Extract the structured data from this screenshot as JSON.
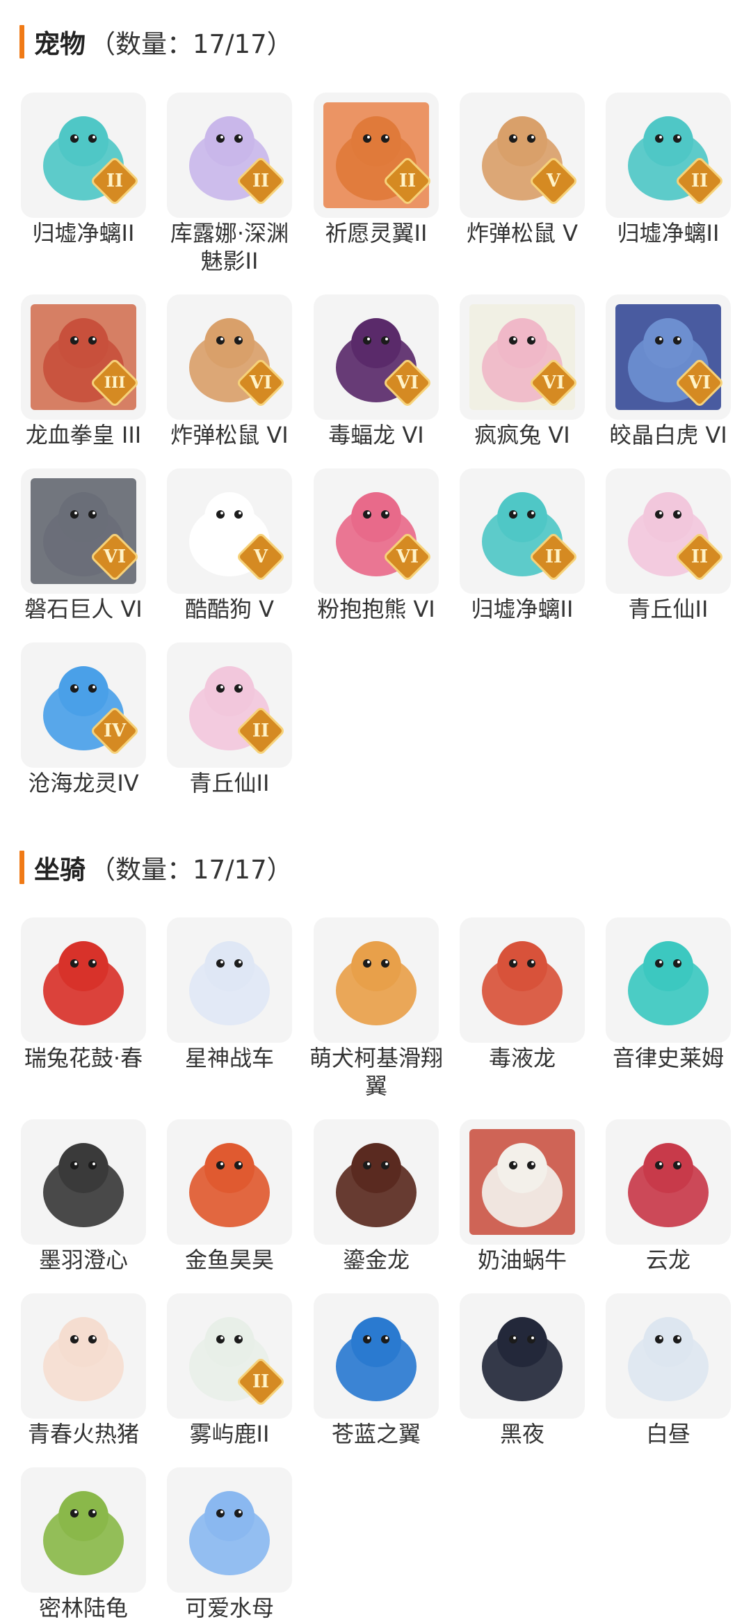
{
  "pets": {
    "title": "宠物",
    "count": "（数量：17/17）",
    "items": [
      {
        "name": "归墟净螭II",
        "icon": "jade-dragon-icon",
        "tier": "II",
        "color": "#4fc7c6",
        "bg": "#f4f4f4"
      },
      {
        "name": "库露娜·深渊魅影II",
        "icon": "abyss-girl-icon",
        "tier": "II",
        "color": "#c9b7ea",
        "bg": "#f4f4f4"
      },
      {
        "name": "祈愿灵翼II",
        "icon": "eagle-spirit-icon",
        "tier": "II",
        "color": "#e07a3a",
        "bg": "#e9824a"
      },
      {
        "name": "炸弹松鼠 V",
        "icon": "bomb-squirrel-icon",
        "tier": "V",
        "color": "#d9a06a",
        "bg": "#f4f4f4"
      },
      {
        "name": "归墟净螭II",
        "icon": "jade-dragon-icon",
        "tier": "II",
        "color": "#4fc7c6",
        "bg": "#f4f4f4"
      },
      {
        "name": "龙血拳皇 III",
        "icon": "ram-beast-icon",
        "tier": "III",
        "color": "#c8503c",
        "bg": "#d06a4a"
      },
      {
        "name": "炸弹松鼠 VI",
        "icon": "bomb-squirrel-icon",
        "tier": "VI",
        "color": "#d9a06a",
        "bg": "#f4f4f4"
      },
      {
        "name": "毒蝠龙 VI",
        "icon": "poison-bat-dragon-icon",
        "tier": "VI",
        "color": "#5a2a6a",
        "bg": "#f4f4f4"
      },
      {
        "name": "疯疯兔 VI",
        "icon": "crazy-rabbit-icon",
        "tier": "VI",
        "color": "#f0b8c8",
        "bg": "#f0eee0"
      },
      {
        "name": "皎晶白虎 VI",
        "icon": "white-tiger-icon",
        "tier": "VI",
        "color": "#6d8fd0",
        "bg": "#2a3f90"
      },
      {
        "name": "磐石巨人 VI",
        "icon": "rock-giant-icon",
        "tier": "VI",
        "color": "#6a6e78",
        "bg": "#5a5f68"
      },
      {
        "name": "酷酷狗 V",
        "icon": "cool-dog-icon",
        "tier": "V",
        "color": "#ffffff",
        "bg": "#f4f4f4"
      },
      {
        "name": "粉抱抱熊 VI",
        "icon": "pink-bear-icon",
        "tier": "VI",
        "color": "#e86a8a",
        "bg": "#f4f4f4"
      },
      {
        "name": "归墟净螭II",
        "icon": "jade-dragon-icon",
        "tier": "II",
        "color": "#4fc7c6",
        "bg": "#f4f4f4"
      },
      {
        "name": "青丘仙II",
        "icon": "fox-fairy-icon",
        "tier": "II",
        "color": "#f2c7dc",
        "bg": "#f4f4f4"
      },
      {
        "name": "沧海龙灵IV",
        "icon": "sea-dragon-spirit-icon",
        "tier": "IV",
        "color": "#4aa0e8",
        "bg": "#f4f4f4"
      },
      {
        "name": "青丘仙II",
        "icon": "fox-fairy-icon",
        "tier": "II",
        "color": "#f2c7dc",
        "bg": "#f4f4f4"
      }
    ]
  },
  "mounts": {
    "title": "坐骑",
    "count": "（数量：17/17）",
    "items": [
      {
        "name": "瑞兔花鼓·春",
        "icon": "rabbit-drum-icon",
        "tier": "",
        "color": "#d8322a",
        "bg": "#f4f4f4"
      },
      {
        "name": "星神战车",
        "icon": "star-horse-icon",
        "tier": "",
        "color": "#dfe7f5",
        "bg": "#f4f4f4"
      },
      {
        "name": "萌犬柯基滑翔翼",
        "icon": "corgi-glider-icon",
        "tier": "",
        "color": "#e8a04a",
        "bg": "#f4f4f4"
      },
      {
        "name": "毒液龙",
        "icon": "venom-dragon-icon",
        "tier": "",
        "color": "#d8523a",
        "bg": "#f4f4f4"
      },
      {
        "name": "音律史莱姆",
        "icon": "music-slime-icon",
        "tier": "",
        "color": "#3cc8c0",
        "bg": "#f4f4f4"
      },
      {
        "name": "墨羽澄心",
        "icon": "ink-feather-icon",
        "tier": "",
        "color": "#3a3a3a",
        "bg": "#f4f4f4"
      },
      {
        "name": "金鱼昊昊",
        "icon": "goldfish-icon",
        "tier": "",
        "color": "#e05a30",
        "bg": "#f4f4f4"
      },
      {
        "name": "鎏金龙",
        "icon": "gilded-dragon-icon",
        "tier": "",
        "color": "#5a2a20",
        "bg": "#f4f4f4"
      },
      {
        "name": "奶油蜗牛",
        "icon": "cream-snail-icon",
        "tier": "",
        "color": "#f3f0ea",
        "bg": "#c84a3a"
      },
      {
        "name": "云龙",
        "icon": "cloud-dragon-icon",
        "tier": "",
        "color": "#c83a4a",
        "bg": "#f4f4f4"
      },
      {
        "name": "青春火热猪",
        "icon": "fire-pig-icon",
        "tier": "",
        "color": "#f5ddd0",
        "bg": "#f4f4f4"
      },
      {
        "name": "雾屿鹿II",
        "icon": "mist-deer-icon",
        "tier": "II",
        "color": "#e8efe8",
        "bg": "#f4f4f4"
      },
      {
        "name": "苍蓝之翼",
        "icon": "azure-wing-icon",
        "tier": "",
        "color": "#2a7ad0",
        "bg": "#f4f4f4"
      },
      {
        "name": "黑夜",
        "icon": "night-dragon-icon",
        "tier": "",
        "color": "#23283a",
        "bg": "#f4f4f4"
      },
      {
        "name": "白昼",
        "icon": "day-dragon-icon",
        "tier": "",
        "color": "#dde6f0",
        "bg": "#f4f4f4"
      },
      {
        "name": "密林陆龟",
        "icon": "forest-tortoise-icon",
        "tier": "",
        "color": "#8ab84a",
        "bg": "#f4f4f4"
      },
      {
        "name": "可爱水母",
        "icon": "cute-jellyfish-icon",
        "tier": "",
        "color": "#8ab8f0",
        "bg": "#f4f4f4"
      }
    ]
  }
}
